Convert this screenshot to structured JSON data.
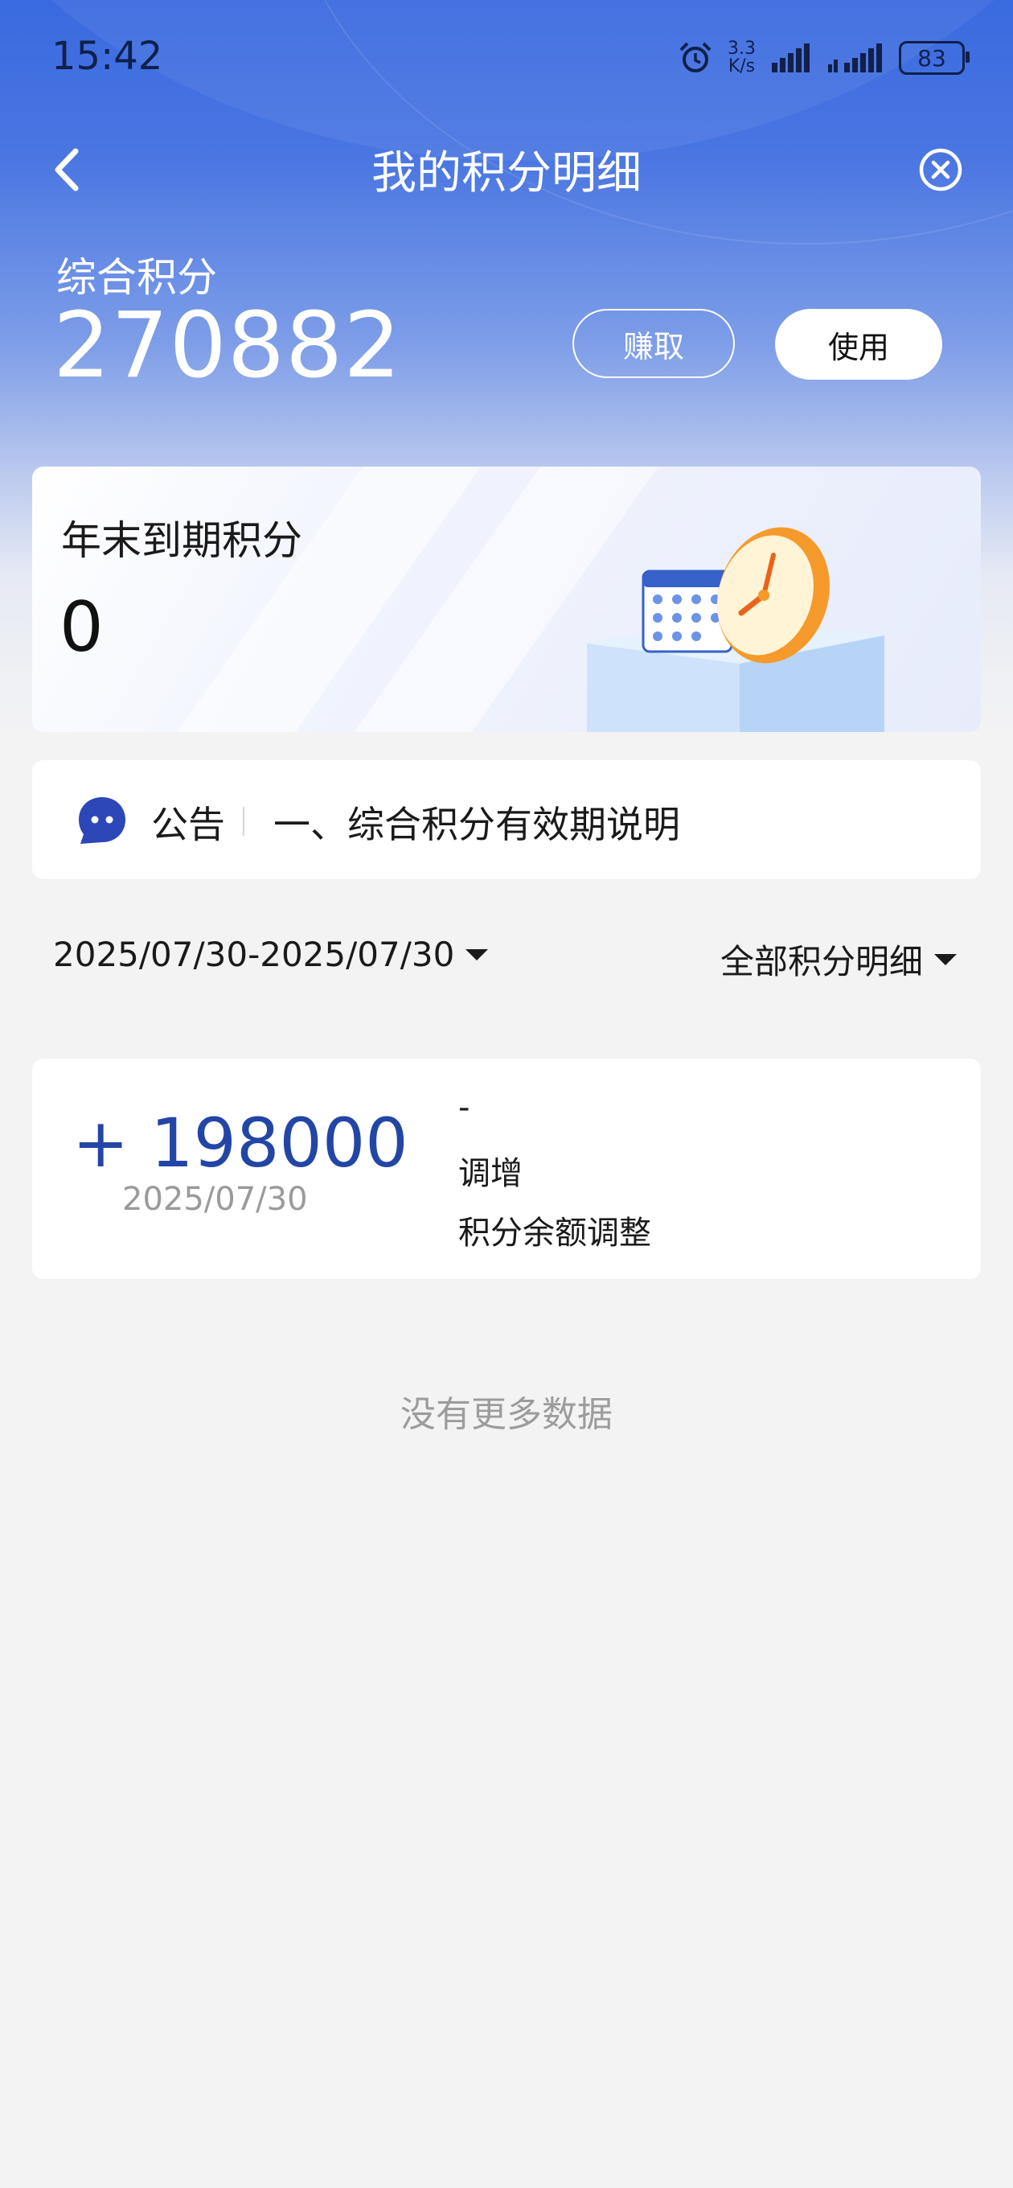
{
  "status_bar": {
    "time": "15:42",
    "net_speed_value": "3.3",
    "net_speed_unit": "K/s",
    "battery": "83",
    "icons": [
      "alarm-icon",
      "signal-icon",
      "signal-icon-2",
      "battery-icon"
    ]
  },
  "nav": {
    "title": "我的积分明细",
    "back_icon": "chevron-left-icon",
    "close_icon": "close-circle-icon"
  },
  "points": {
    "label": "综合积分",
    "value": "270882",
    "earn_label": "赚取",
    "use_label": "使用"
  },
  "expiry": {
    "title": "年末到期积分",
    "value": "0"
  },
  "notice": {
    "label": "公告",
    "text": "一、综合积分有效期说明"
  },
  "filters": {
    "date_range": "2025/07/30-2025/07/30",
    "type": "全部积分明细"
  },
  "records": [
    {
      "amount": "+ 198000",
      "date": "2025/07/30",
      "line1": "-",
      "line2": "调增",
      "line3": "积分余额调整"
    }
  ],
  "footer_text": "没有更多数据",
  "colors": {
    "header_blue": "#3a6ae0",
    "amount_blue": "#2346a6",
    "background": "#f3f3f4"
  }
}
